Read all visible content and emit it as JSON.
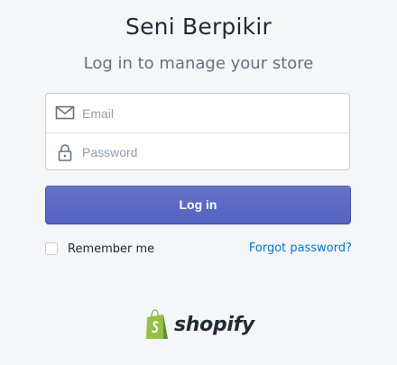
{
  "header": {
    "store_name": "Seni Berpikir",
    "subtitle": "Log in to manage your store"
  },
  "form": {
    "email": {
      "placeholder": "Email",
      "value": "",
      "icon": "envelope-icon"
    },
    "password": {
      "placeholder": "Password",
      "value": "",
      "icon": "lock-icon"
    },
    "login_label": "Log in",
    "remember_label": "Remember me",
    "remember_checked": false,
    "forgot_label": "Forgot password?"
  },
  "branding": {
    "wordmark": "shopify",
    "icon": "shopify-bag-icon"
  },
  "colors": {
    "background": "#f4f6f8",
    "button": "#5c6ac4",
    "link": "#007ace",
    "brand_green": "#95bf47"
  }
}
